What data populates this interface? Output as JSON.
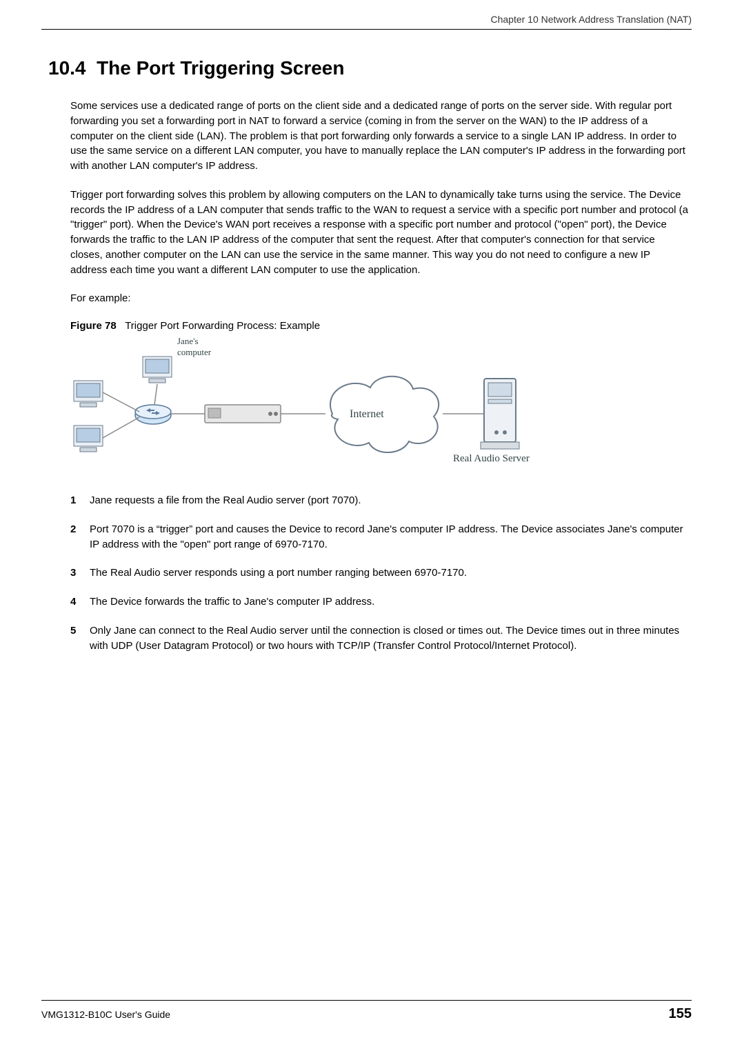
{
  "header": {
    "chapter_line": "Chapter 10 Network Address Translation (NAT)"
  },
  "section": {
    "number": "10.4",
    "title": "The Port Triggering Screen"
  },
  "paragraphs": {
    "p1": "Some services use a dedicated range of ports on the client side and a dedicated range of ports on the server side. With regular port forwarding you set a forwarding port in NAT to forward a service (coming in from the server on the WAN) to the IP address of a computer on the client side (LAN). The problem is that port forwarding only forwards a service to a single LAN IP address. In order to use the same service on a different LAN computer, you have to manually replace the LAN computer's IP address in the forwarding port with another LAN computer's IP address.",
    "p2": "Trigger port forwarding solves this problem by allowing computers on the LAN to dynamically take turns using the service. The Device records the IP address of a LAN computer that sends traffic to the WAN to request a service with a specific port number and protocol (a \"trigger\" port). When the Device's WAN port receives a response with a specific port number and protocol (\"open\" port), the Device forwards the traffic to the LAN IP address of the computer that sent the request. After that computer's connection for that service closes, another computer on the LAN can use the service in the same manner. This way you do not need to configure a new IP address each time you want a different LAN computer to use the application.",
    "p3": "For example:"
  },
  "figure": {
    "label": "Figure 78",
    "caption": "Trigger Port Forwarding Process: Example",
    "labels": {
      "jane": "Jane's",
      "jane2": "computer",
      "internet": "Internet",
      "server": "Real Audio Server"
    }
  },
  "steps": [
    {
      "n": "1",
      "text": "Jane requests a file from the Real Audio server (port 7070)."
    },
    {
      "n": "2",
      "text": "Port 7070 is a “trigger” port and causes the Device to record Jane's computer IP address. The Device associates Jane's computer IP address with the \"open\" port range of 6970-7170."
    },
    {
      "n": "3",
      "text": "The Real Audio server responds using a port number ranging between 6970-7170."
    },
    {
      "n": "4",
      "text": "The Device forwards the traffic to Jane's computer IP address."
    },
    {
      "n": "5",
      "text": "Only Jane can connect to the Real Audio server until the connection is closed or times out. The Device times out in three minutes with UDP (User Datagram Protocol) or two hours with TCP/IP (Transfer Control Protocol/Internet Protocol)."
    }
  ],
  "footer": {
    "guide": "VMG1312-B10C User's Guide",
    "page": "155"
  }
}
